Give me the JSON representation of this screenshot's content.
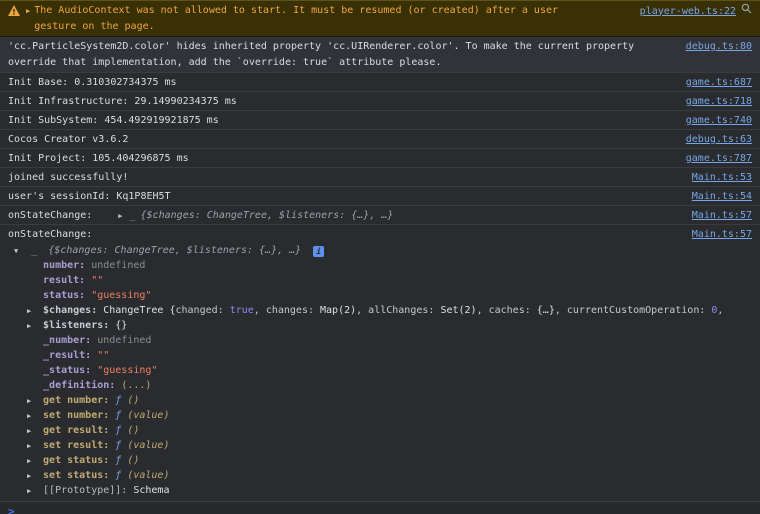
{
  "colors": {
    "link": "#77a5e6",
    "warning_text": "#eda63f",
    "warning_bg": "#3a3005",
    "string_value": "#ee8063",
    "number_boolean": "#9585f0",
    "property_key": "#ab9ed2",
    "prompt_chevron": "#3d7df2"
  },
  "icons": {
    "expand": "▶",
    "collapse": "▼",
    "info": "i",
    "prompt": ">"
  },
  "rows": {
    "audio_warning": {
      "line1": "The AudioContext was not allowed to start. It must be resumed (or created) after a user",
      "line2": "gesture on the page.",
      "link": "player-web.ts:22"
    },
    "cc_warning": {
      "line1": "'cc.ParticleSystem2D.color' hides inherited property 'cc.UIRenderer.color'. To make the current property",
      "line2": "override that implementation, add the `override: true` attribute please.",
      "link": "debug.ts:80"
    },
    "logs": [
      {
        "text": "Init Base: 0.310302734375 ms",
        "link": "game.ts:687"
      },
      {
        "text": "Init Infrastructure: 29.14990234375 ms",
        "link": "game.ts:718"
      },
      {
        "text": "Init SubSystem: 454.492919921875 ms",
        "link": "game.ts:740"
      },
      {
        "text": "Cocos Creator v3.6.2",
        "link": "debug.ts:63"
      },
      {
        "text": "Init Project: 105.404296875 ms",
        "link": "game.ts:787"
      },
      {
        "text": "joined successfully!",
        "link": "Main.ts:53"
      },
      {
        "text": "user's sessionId: Kq1P8EH5T",
        "link": "Main.ts:54"
      }
    ],
    "state_collapsed": {
      "label": "onStateChange:",
      "class_name": "_",
      "preview": "{$changes: ChangeTree, $listeners: {…}, …}",
      "link": "Main.ts:57"
    },
    "state_expanded": {
      "label": "onStateChange:",
      "class_name": "_",
      "preview": "{$changes: ChangeTree, $listeners: {…}, …}",
      "link": "Main.ts:57"
    }
  },
  "tree": {
    "items": [
      {
        "key": "number: ",
        "value": "undefined"
      },
      {
        "key": "result: ",
        "value": "\"\""
      },
      {
        "key": "status: ",
        "value": "\"guessing\""
      },
      {
        "key": "$changes: ",
        "cls": "ChangeTree {",
        "k1": "changed: ",
        "v1": "true",
        "k2": ", changes: ",
        "v2": "Map(2)",
        "k3": ", allChanges: ",
        "v3": "Set(2)",
        "k4": ", caches: ",
        "v4": "{…}",
        "k5": ", currentCustomOperation: ",
        "v5": "0",
        "k6": ","
      },
      {
        "key": "$listeners: ",
        "value": "{}"
      },
      {
        "key": "_number: ",
        "value": "undefined"
      },
      {
        "key": "_result: ",
        "value": "\"\""
      },
      {
        "key": "_status: ",
        "value": "\"guessing\""
      },
      {
        "key": "_definition: ",
        "value": "(...)"
      },
      {
        "key": "get number: ",
        "fn": "ƒ ",
        "args": "()"
      },
      {
        "key": "set number: ",
        "fn": "ƒ ",
        "args": "(value)"
      },
      {
        "key": "get result: ",
        "fn": "ƒ ",
        "args": "()"
      },
      {
        "key": "set result: ",
        "fn": "ƒ ",
        "args": "(value)"
      },
      {
        "key": "get status: ",
        "fn": "ƒ ",
        "args": "()"
      },
      {
        "key": "set status: ",
        "fn": "ƒ ",
        "args": "(value)"
      },
      {
        "key": "[[Prototype]]: ",
        "value": "Schema"
      }
    ]
  }
}
